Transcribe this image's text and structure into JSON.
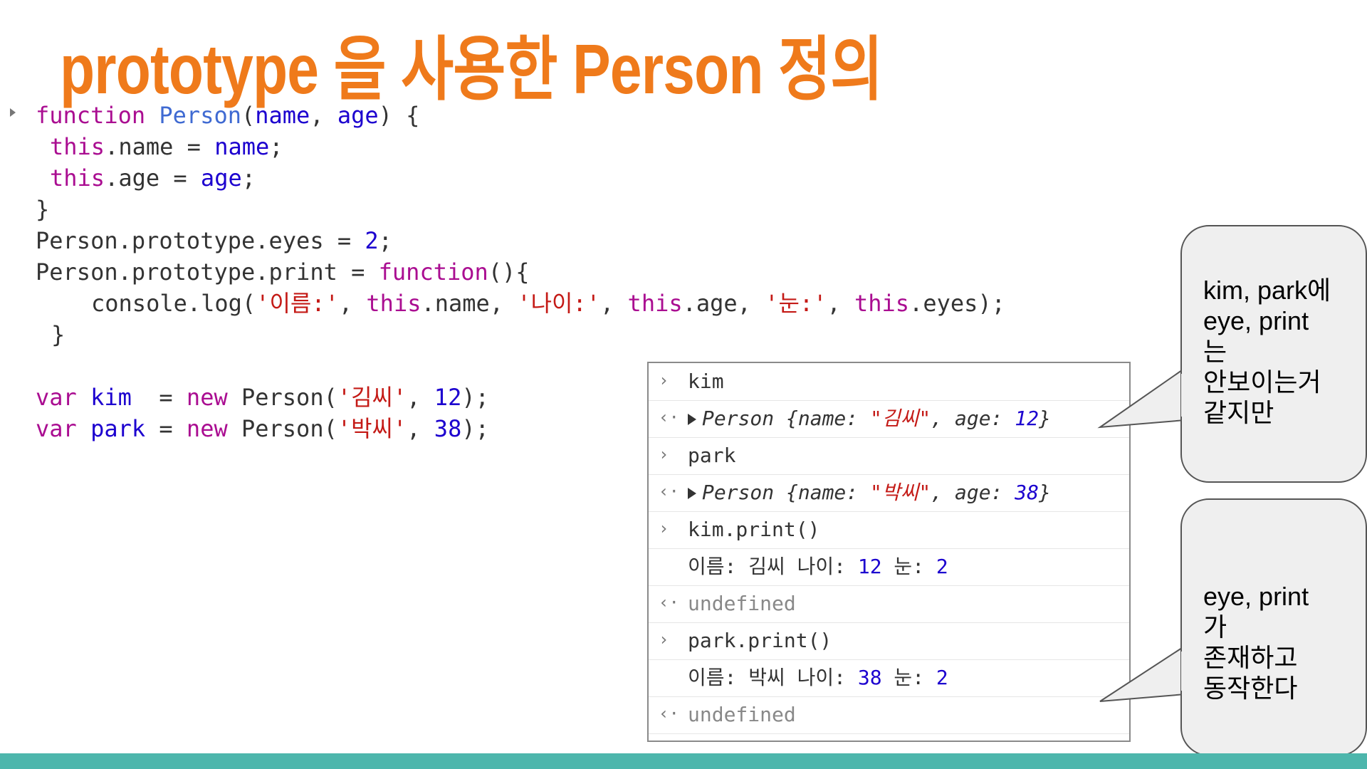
{
  "slide": {
    "title": "prototype 을 사용한 Person 정의",
    "accent_color": "#ef7a1b",
    "bar_color": "#4db6ac"
  },
  "code": {
    "l1": {
      "kw": "function",
      "fn": "Person",
      "a": "(",
      "p1": "name",
      "b": ", ",
      "p2": "age",
      "c": ") {"
    },
    "l2": {
      "kw": "this",
      "a": ".name = ",
      "v": "name",
      "b": ";"
    },
    "l3": {
      "kw": "this",
      "a": ".age = ",
      "v": "age",
      "b": ";"
    },
    "l4": "}",
    "l5": {
      "a": "Person.prototype.eyes = ",
      "n": "2",
      "b": ";"
    },
    "l6": {
      "a": "Person.prototype.print = ",
      "kw": "function",
      "b": "(){"
    },
    "l7": {
      "a": "console.log(",
      "s1": "'이름:'",
      "b": ", ",
      "t1": "this",
      "c": ".name, ",
      "s2": "'나이:'",
      "d": ", ",
      "t2": "this",
      "e": ".age, ",
      "s3": "'눈:'",
      "f": ", ",
      "t3": "this",
      "g": ".eyes);"
    },
    "l8": "}",
    "l9": {
      "kw1": "var",
      "v": "kim",
      "a": "  = ",
      "kw2": "new",
      "b": " Person(",
      "s": "'김씨'",
      "c": ", ",
      "n": "12",
      "d": ");"
    },
    "l10": {
      "kw1": "var",
      "v": "park",
      "a": " = ",
      "kw2": "new",
      "b": " Person(",
      "s": "'박씨'",
      "c": ", ",
      "n": "38",
      "d": ");"
    }
  },
  "console": {
    "r1": {
      "icon": "›",
      "text": "kim"
    },
    "r2": {
      "icon": "‹·",
      "pre": "Person {name: ",
      "name": "\"김씨\"",
      "mid": ", age: ",
      "age": "12",
      "post": "}"
    },
    "r3": {
      "icon": "›",
      "text": "park"
    },
    "r4": {
      "icon": "‹·",
      "pre": "Person {name: ",
      "name": "\"박씨\"",
      "mid": ", age: ",
      "age": "38",
      "post": "}"
    },
    "r5": {
      "icon": "›",
      "text": "kim.print()"
    },
    "r6": {
      "a": "이름: 김씨 나이: ",
      "n1": "12",
      "b": " 눈: ",
      "n2": "2"
    },
    "r7": {
      "icon": "‹·",
      "text": "undefined"
    },
    "r8": {
      "icon": "›",
      "text": "park.print()"
    },
    "r9": {
      "a": "이름: 박씨 나이: ",
      "n1": "38",
      "b": " 눈: ",
      "n2": "2"
    },
    "r10": {
      "icon": "‹·",
      "text": "undefined"
    }
  },
  "callouts": {
    "top": [
      "kim, park에",
      "eye, print",
      "는",
      "안보이는거",
      "같지만"
    ],
    "bottom": [
      "eye, print",
      "가",
      "존재하고",
      "동작한다"
    ]
  }
}
